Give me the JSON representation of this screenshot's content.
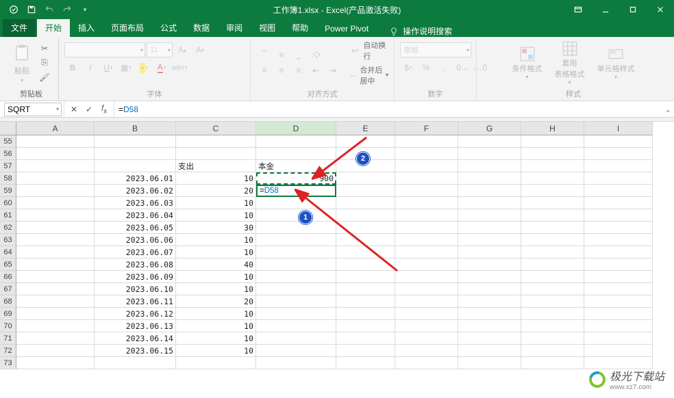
{
  "title": "工作簿1.xlsx  -  Excel(产品激活失败)",
  "tabs": {
    "file": "文件",
    "home": "开始",
    "insert": "插入",
    "layout": "页面布局",
    "formulas": "公式",
    "data": "数据",
    "review": "审阅",
    "view": "视图",
    "help": "帮助",
    "powerpivot": "Power Pivot",
    "tellme": "操作说明搜索"
  },
  "ribbon": {
    "paste": "粘贴",
    "clipboard_label": "剪贴板",
    "font_label": "字体",
    "align_label": "对齐方式",
    "number_label": "数字",
    "style_label": "样式",
    "wrap": "自动换行",
    "merge": "合并后居中",
    "general": "常规",
    "cond_fmt": "条件格式",
    "table_fmt1": "套用",
    "table_fmt2": "表格格式",
    "cell_style": "单元格样式",
    "font_size_placeholder": "11"
  },
  "namebox": "SQRT",
  "formula": {
    "prefix": "=",
    "ref": "D58"
  },
  "columns": [
    "A",
    "B",
    "C",
    "D",
    "E",
    "F",
    "G",
    "H",
    "I"
  ],
  "rowstart": 55,
  "rowend": 73,
  "headers": {
    "C57": "支出",
    "D57": "本金"
  },
  "dates": [
    "2023.06.01",
    "2023.06.02",
    "2023.06.03",
    "2023.06.04",
    "2023.06.05",
    "2023.06.06",
    "2023.06.07",
    "2023.06.08",
    "2023.06.09",
    "2023.06.10",
    "2023.06.11",
    "2023.06.12",
    "2023.06.13",
    "2023.06.14",
    "2023.06.15"
  ],
  "cvals": [
    10,
    20,
    10,
    10,
    30,
    10,
    10,
    40,
    10,
    10,
    20,
    10,
    10,
    10,
    10
  ],
  "d58": 900,
  "active_formula": {
    "prefix": "=",
    "ref": "D58"
  },
  "annotations": {
    "badge1": "1",
    "badge2": "2"
  },
  "watermark": {
    "main": "极光下载站",
    "sub": "www.xz7.com"
  }
}
